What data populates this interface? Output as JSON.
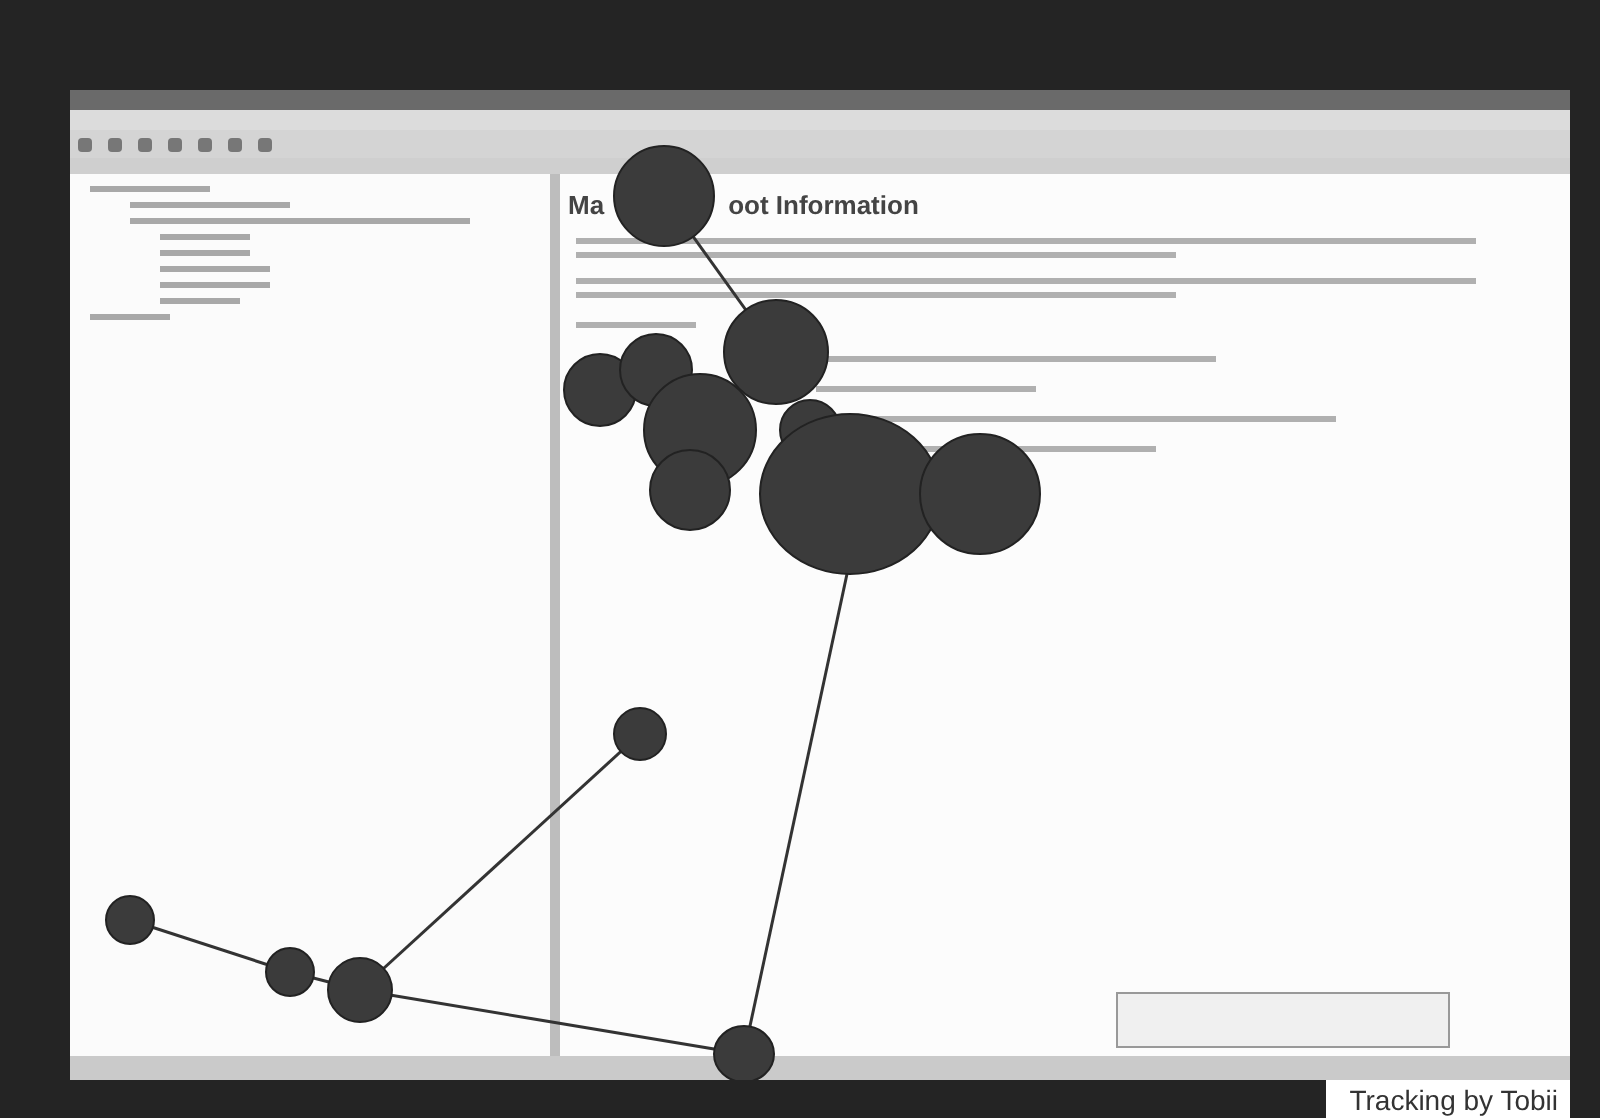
{
  "document": {
    "heading_parts": [
      "Ma",
      "oot Information"
    ]
  },
  "caption": "Tracking by Tobii"
}
